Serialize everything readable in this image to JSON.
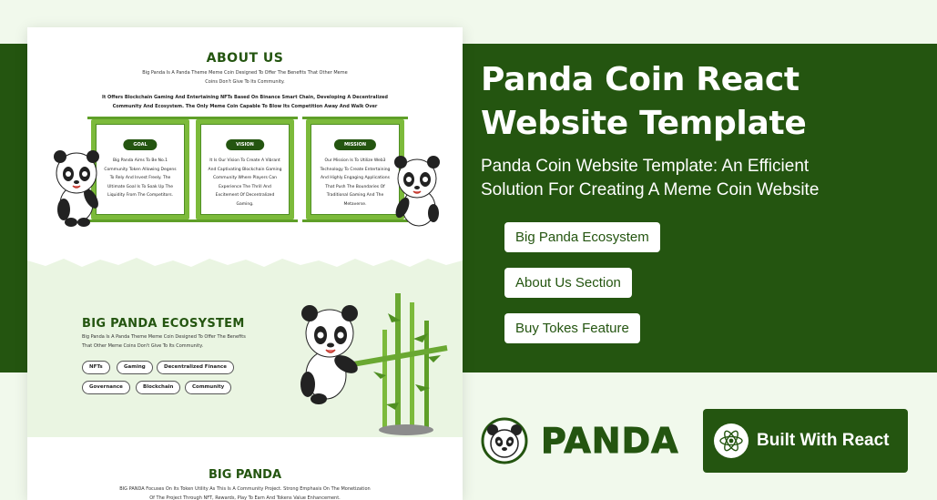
{
  "colors": {
    "brand_green": "#245510",
    "bamboo_green": "#7cba3b",
    "page_bg": "#f1f9ec",
    "white": "#ffffff"
  },
  "preview": {
    "about": {
      "title": "ABOUT US",
      "intro": "Big Panda Is A Panda Theme Meme Coin Designed To Offer The Benefits That Other Meme Coins Don't Give To Its Community.",
      "highlight": "It Offers Blockchain Gaming And Entertaining NFTs Based On Binance Smart Chain, Developing A Decentralized Community And Ecosystem. The Only Meme Coin Capable To Blow Its Competition Away And Walk Over",
      "cards": [
        {
          "label": "GOAL",
          "text": "Big Panda Aims To Be No.1 Community Token Allowing Degens To Rely And Invest Freely. The Ultimate Goal Is To Soak Up The Liquidity From The Competitors."
        },
        {
          "label": "VISION",
          "text": "It Is Our Vision To Create A Vibrant And Captivating Blockchain Gaming Community Where Players Can Experience The Thrill And Excitement Of Decentralized Gaming."
        },
        {
          "label": "MISSION",
          "text": "Our Mission Is To Utilize Web3 Technology To Create Entertaining And Highly Engaging Applications That Push The Boundaries Of Traditional Gaming And The Metaverse."
        }
      ]
    },
    "ecosystem": {
      "title": "BIG PANDA ECOSYSTEM",
      "text": "Big Panda Is A Panda Theme Meme Coin Designed To Offer The Benefits That Other Meme Coins Don't Give To Its Community.",
      "tags": [
        "NFTs",
        "Gaming",
        "Decentralized Finance",
        "Governance",
        "Blockchain",
        "Community"
      ]
    },
    "big_panda": {
      "title": "BIG PANDA",
      "text": "BIG PANDA Focuses On Its Token Utility As This Is A Community Project. Strong Emphasis On The Monetization Of The Project Through NFT, Rewards, Play To Earn And Tokens Value Enhancement."
    }
  },
  "hero": {
    "title_line1": "Panda Coin React",
    "title_line2": "Website Template",
    "subtitle_line1": "Panda Coin Website Template: An Efficient",
    "subtitle_line2": "Solution For Creating A Meme Coin Website",
    "features": [
      "Big Panda Ecosystem",
      "About Us Section",
      "Buy Tokes Feature"
    ]
  },
  "brand": {
    "name": "PANDA",
    "logo_icon": "panda-face-icon"
  },
  "react_badge": {
    "label": "Built With React",
    "icon": "react-atom-icon"
  }
}
